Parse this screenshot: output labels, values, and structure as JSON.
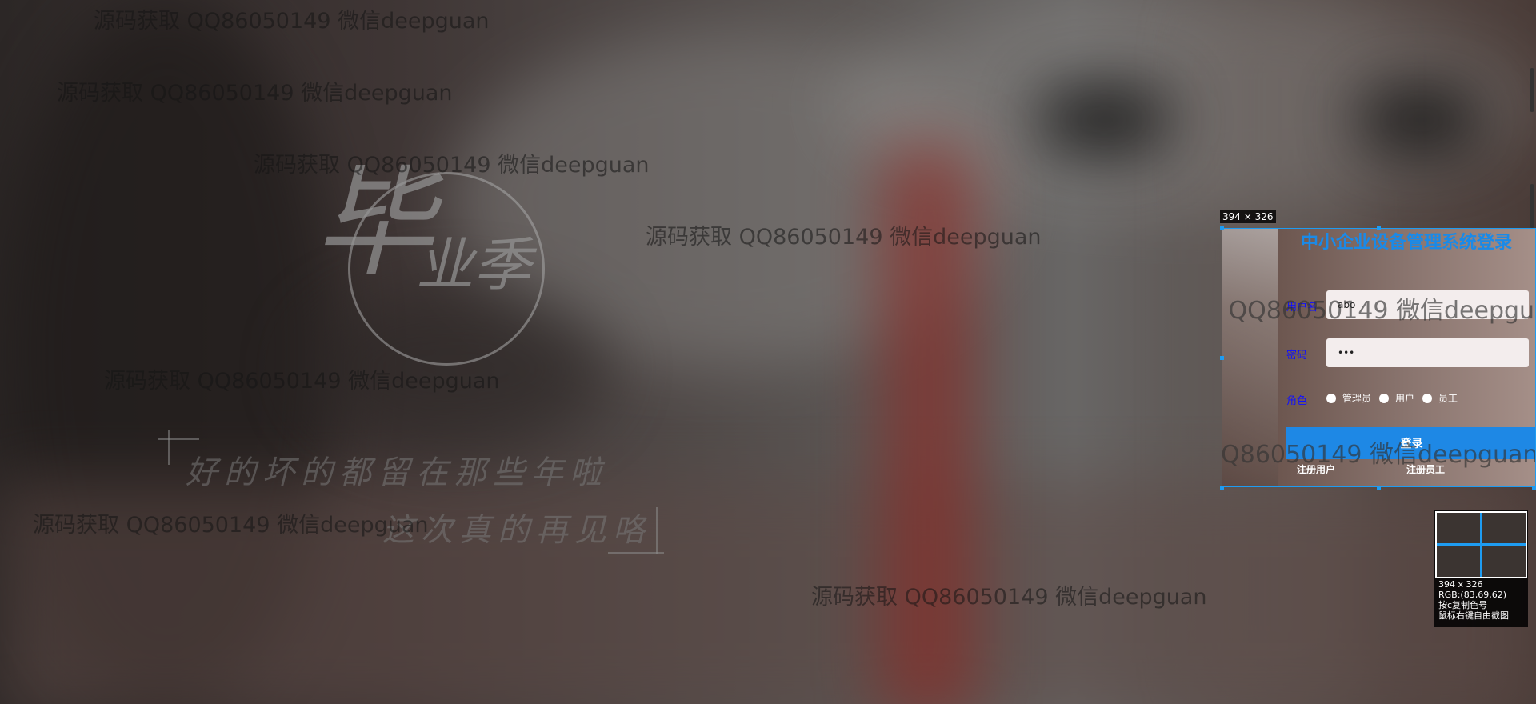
{
  "logo": {
    "main": "毕",
    "sub": "业季"
  },
  "poem": {
    "line1": "好的坏的都留在那些年啦",
    "line2": "这次真的再见咯"
  },
  "watermark_text": "源码获取 QQ86050149 微信deepguan",
  "login": {
    "size_tag": "394 × 326",
    "title": "中小企业设备管理系统登录",
    "username_label": "用户名",
    "username_value": "abo",
    "password_label": "密码",
    "password_value": "•••",
    "role_label": "角色",
    "roles": [
      "管理员",
      "用户",
      "员工"
    ],
    "login_button": "登录",
    "register_user": "注册用户",
    "register_staff": "注册员工",
    "accent_color": "#1e88e5"
  },
  "magnifier": {
    "size": "394 x 326",
    "rgb": "RGB:(83,69,62)",
    "hint1": "按c复制色号",
    "hint2": "鼠标右键自由截图"
  }
}
